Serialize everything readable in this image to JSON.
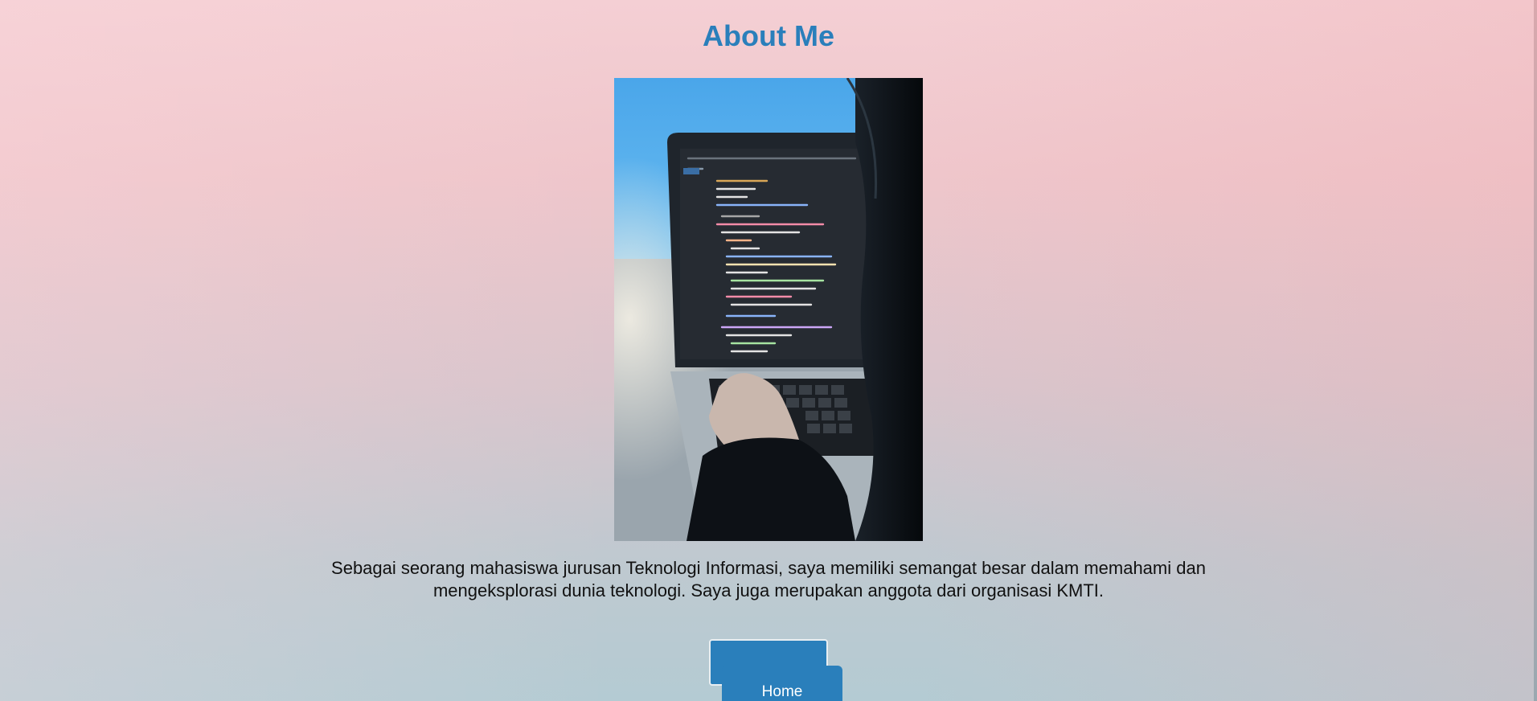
{
  "page": {
    "title": "About Me",
    "description": "Sebagai seorang mahasiswa jurusan Teknologi Informasi, saya memiliki semangat besar dalam memahami dan mengeksplorasi dunia teknologi. Saya juga merupakan anggota dari organisasi KMTI.",
    "home_label": "Home"
  },
  "colors": {
    "accent": "#2a7fbb",
    "text": "#111111"
  },
  "icons": {
    "photo": "laptop-coding-photo"
  }
}
